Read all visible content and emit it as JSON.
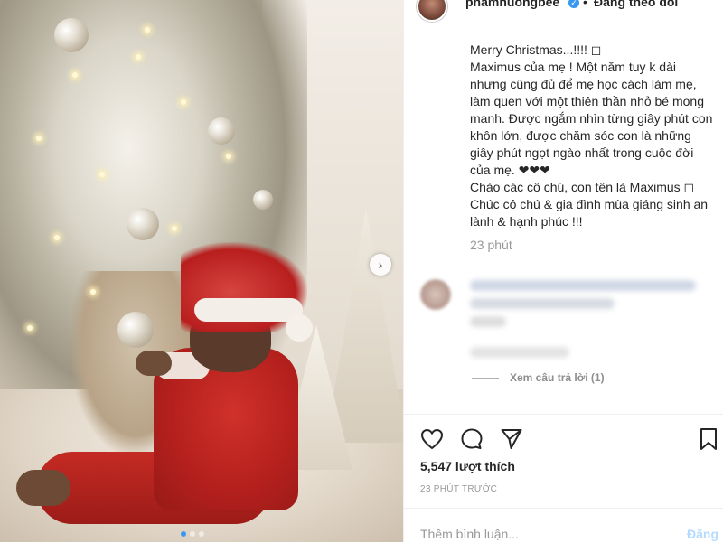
{
  "post": {
    "username": "phamhuongbee",
    "separator": "•",
    "follow_status": "Đang theo dõi",
    "caption_lines": [
      "Merry Christmas...!!!! ◻",
      "Maximus của mẹ ! Một năm tuy k dài nhưng cũng đủ để mẹ học cách làm mẹ, làm quen với một thiên thần nhỏ bé mong manh. Được ngắm nhìn từng giây phút con khôn lớn, được chăm sóc con là những giây phút ngọt ngào nhất trong cuộc đời của mẹ. ❤❤❤",
      "Chào các cô chú, con tên là Maximus ◻ Chúc cô chú & gia đình mùa giáng sinh an lành & hạnh phúc !!!"
    ],
    "caption_time": "23 phút",
    "view_replies": "Xem câu trả lời (1)",
    "likes": "5,547 lượt thích",
    "posted_ago": "23 PHÚT TRƯỚC",
    "comment_placeholder": "Thêm bình luận...",
    "post_button": "Đăng"
  },
  "photo": {
    "next_arrow": "›",
    "carousel_count": 3,
    "carousel_active": 0
  },
  "icons": {
    "verified": "✓",
    "like": "heart-icon",
    "comment": "comment-icon",
    "share": "share-icon",
    "save": "bookmark-icon"
  },
  "colors": {
    "accent": "#3897f0",
    "post_disabled": "#b3dbff",
    "muted": "#999999"
  }
}
